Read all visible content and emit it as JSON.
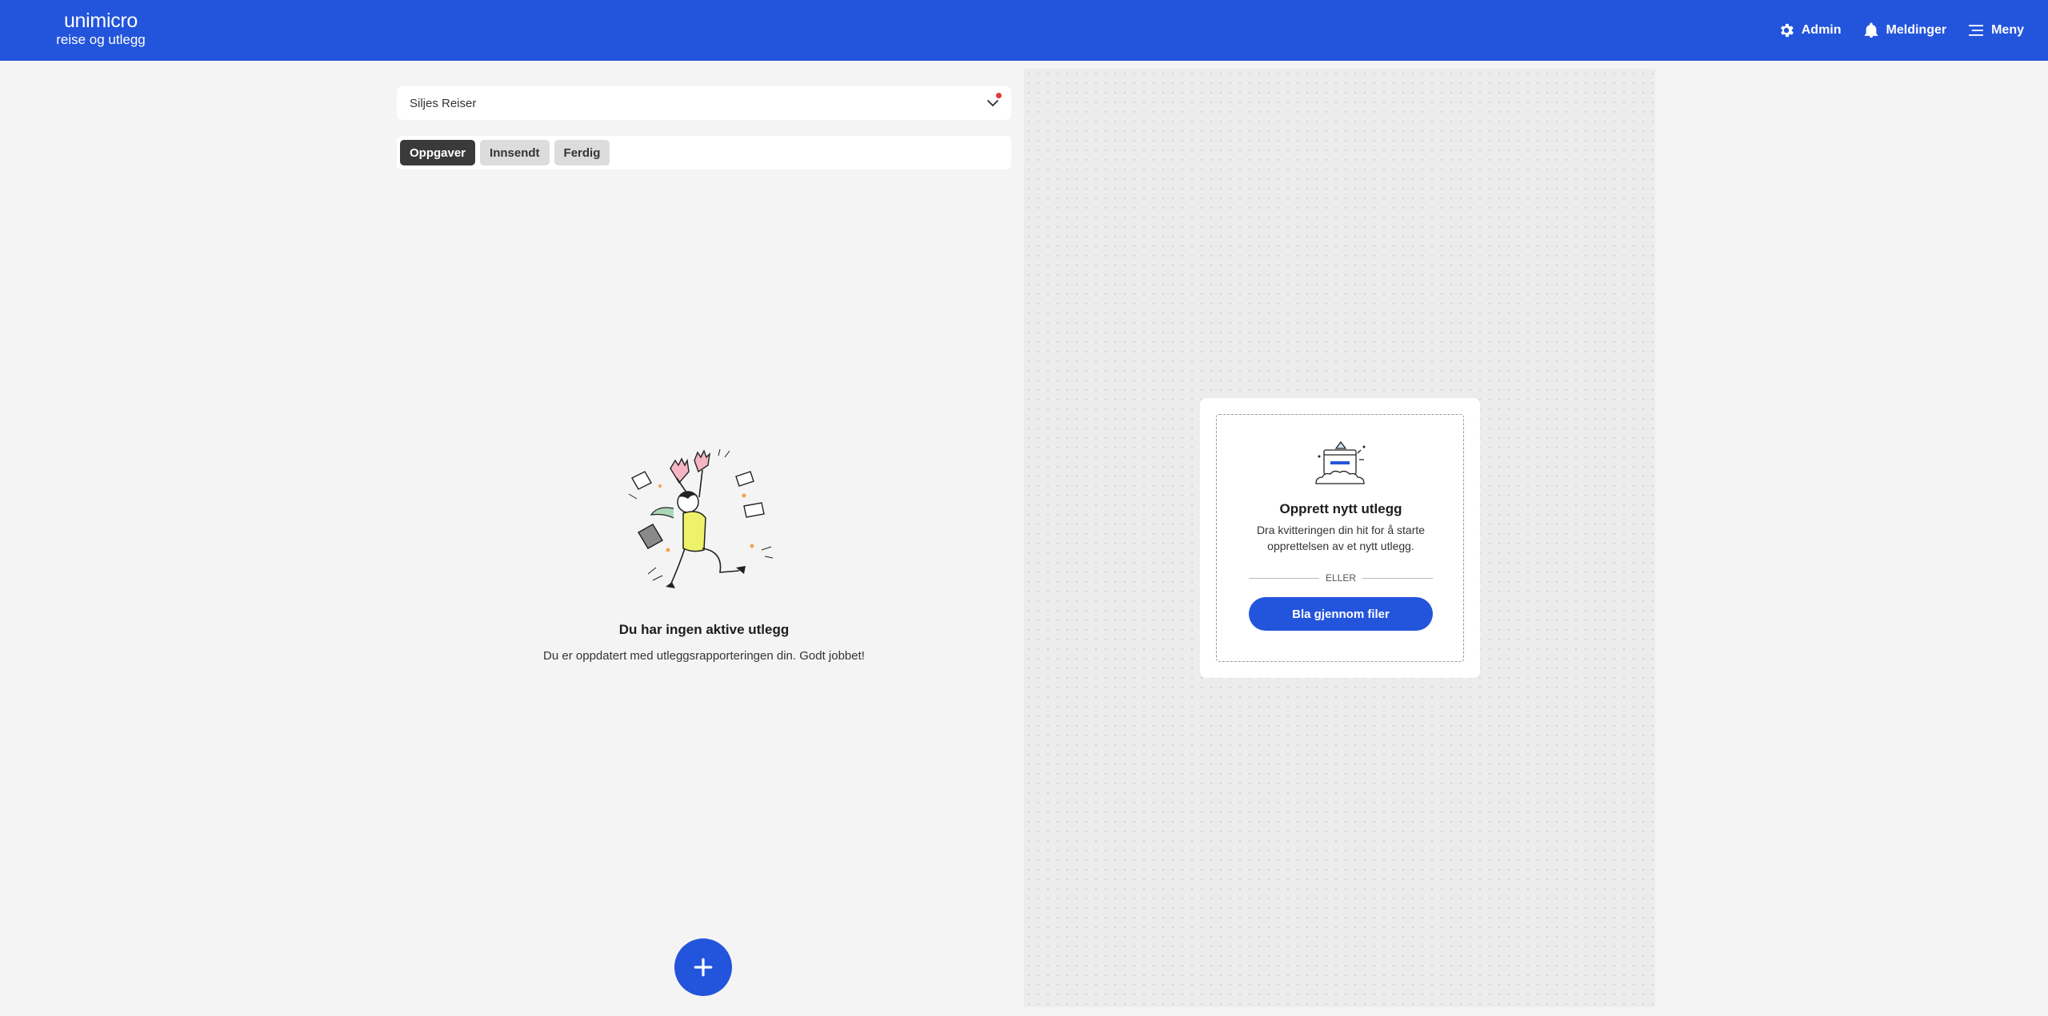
{
  "header": {
    "logo_line1": "unimicro",
    "logo_line2": "reise og utlegg",
    "nav": [
      {
        "label": "Admin",
        "icon": "gear-icon"
      },
      {
        "label": "Meldinger",
        "icon": "bell-icon"
      },
      {
        "label": "Meny",
        "icon": "menu-icon"
      }
    ]
  },
  "trip_select": {
    "value": "Siljes Reiser",
    "has_notification": true
  },
  "tabs": [
    {
      "label": "Oppgaver",
      "active": true
    },
    {
      "label": "Innsendt",
      "active": false
    },
    {
      "label": "Ferdig",
      "active": false
    }
  ],
  "empty_state": {
    "title": "Du har ingen aktive utlegg",
    "subtitle": "Du er oppdatert med utleggsrapporteringen din. Godt jobbet!"
  },
  "upload_card": {
    "title": "Opprett nytt utlegg",
    "subtitle": "Dra kvitteringen din hit for å starte opprettelsen av et nytt utlegg.",
    "divider_text": "ELLER",
    "button_label": "Bla gjennom filer"
  },
  "colors": {
    "primary": "#2354dc",
    "background": "#f4f4f4",
    "tab_active": "#3a3a3a",
    "notification": "#e53935"
  }
}
